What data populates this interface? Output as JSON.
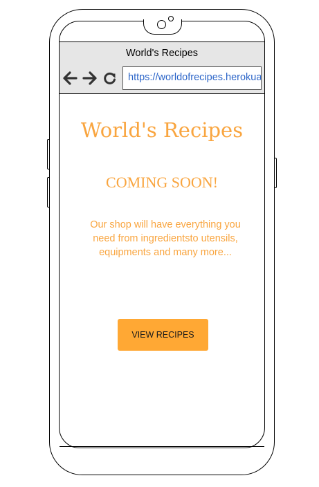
{
  "browser": {
    "tab_title": "World's Recipes",
    "url": "https://worldofrecipes.herokuapp.com",
    "icons": [
      "arrow-left-icon",
      "arrow-right-icon",
      "reload-icon"
    ]
  },
  "page": {
    "title": "World's Recipes",
    "coming_soon": "COMING SOON!",
    "description": "Our shop will have everything you need from ingredientsto utensils, equipments and many more...",
    "cta_label": "VIEW RECIPES"
  },
  "colors": {
    "accent": "#f9a53f",
    "button": "#ffa834",
    "browser_bar": "#e6e6e6",
    "link": "#2a64c8"
  }
}
